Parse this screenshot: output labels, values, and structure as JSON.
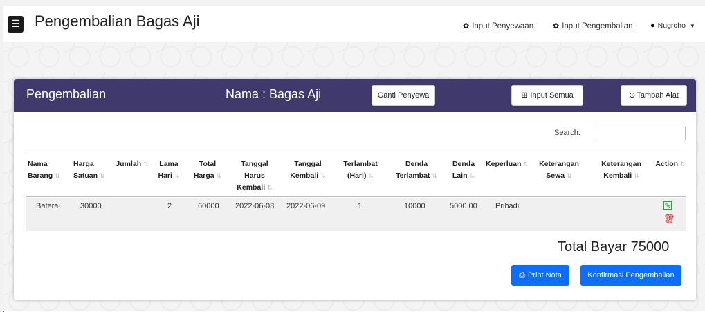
{
  "navbar": {
    "title": "Pengembalian Bagas Aji",
    "menu_icon": "menu-icon",
    "links": [
      {
        "label": "Input Penyewaan",
        "icon": "leaf-icon"
      },
      {
        "label": "Input Pengembalian",
        "icon": "leaf-icon"
      }
    ],
    "user": {
      "name": "Nugroho",
      "icon": "user-icon"
    }
  },
  "card": {
    "title": "Pengembalian",
    "renter_label": "Nama : Bagas Aji",
    "change_renter_button": "Ganti Penyewa",
    "input_all_button": "Input Semua",
    "add_tool_button": "Tambah Alat"
  },
  "search": {
    "label": "Search:",
    "value": ""
  },
  "table": {
    "headers": [
      "Nama Barang",
      "Harga Satuan",
      "Jumlah",
      "Lama Hari",
      "Total Harga",
      "Tanggal Harus Kembali",
      "Tanggal Kembali",
      "Terlambat (Hari)",
      "Denda Terlambat",
      "Denda Lain",
      "Keperluan",
      "Keterangan Sewa",
      "Keterangan Kembali",
      "Action"
    ],
    "rows": [
      {
        "nama_barang": "Baterai",
        "harga_satuan": "30000",
        "jumlah": "",
        "lama_hari": "2",
        "total_harga": "60000",
        "tanggal_harus_kembali": "2022-06-08",
        "tanggal_kembali": "2022-06-09",
        "terlambat": "1",
        "denda_terlambat": "10000",
        "denda_lain": "5000.00",
        "keperluan": "Pribadi",
        "keterangan_sewa": "",
        "keterangan_kembali": ""
      }
    ]
  },
  "summary": {
    "total": "Total Bayar 75000"
  },
  "actions": {
    "print_button": "Print Nota",
    "confirm_button": "Konfirmasi Pengembalian"
  },
  "colors": {
    "header_bg": "#3f3a6b",
    "primary": "#0d6efd",
    "edit": "#2e9e44",
    "delete": "#d9302c"
  }
}
